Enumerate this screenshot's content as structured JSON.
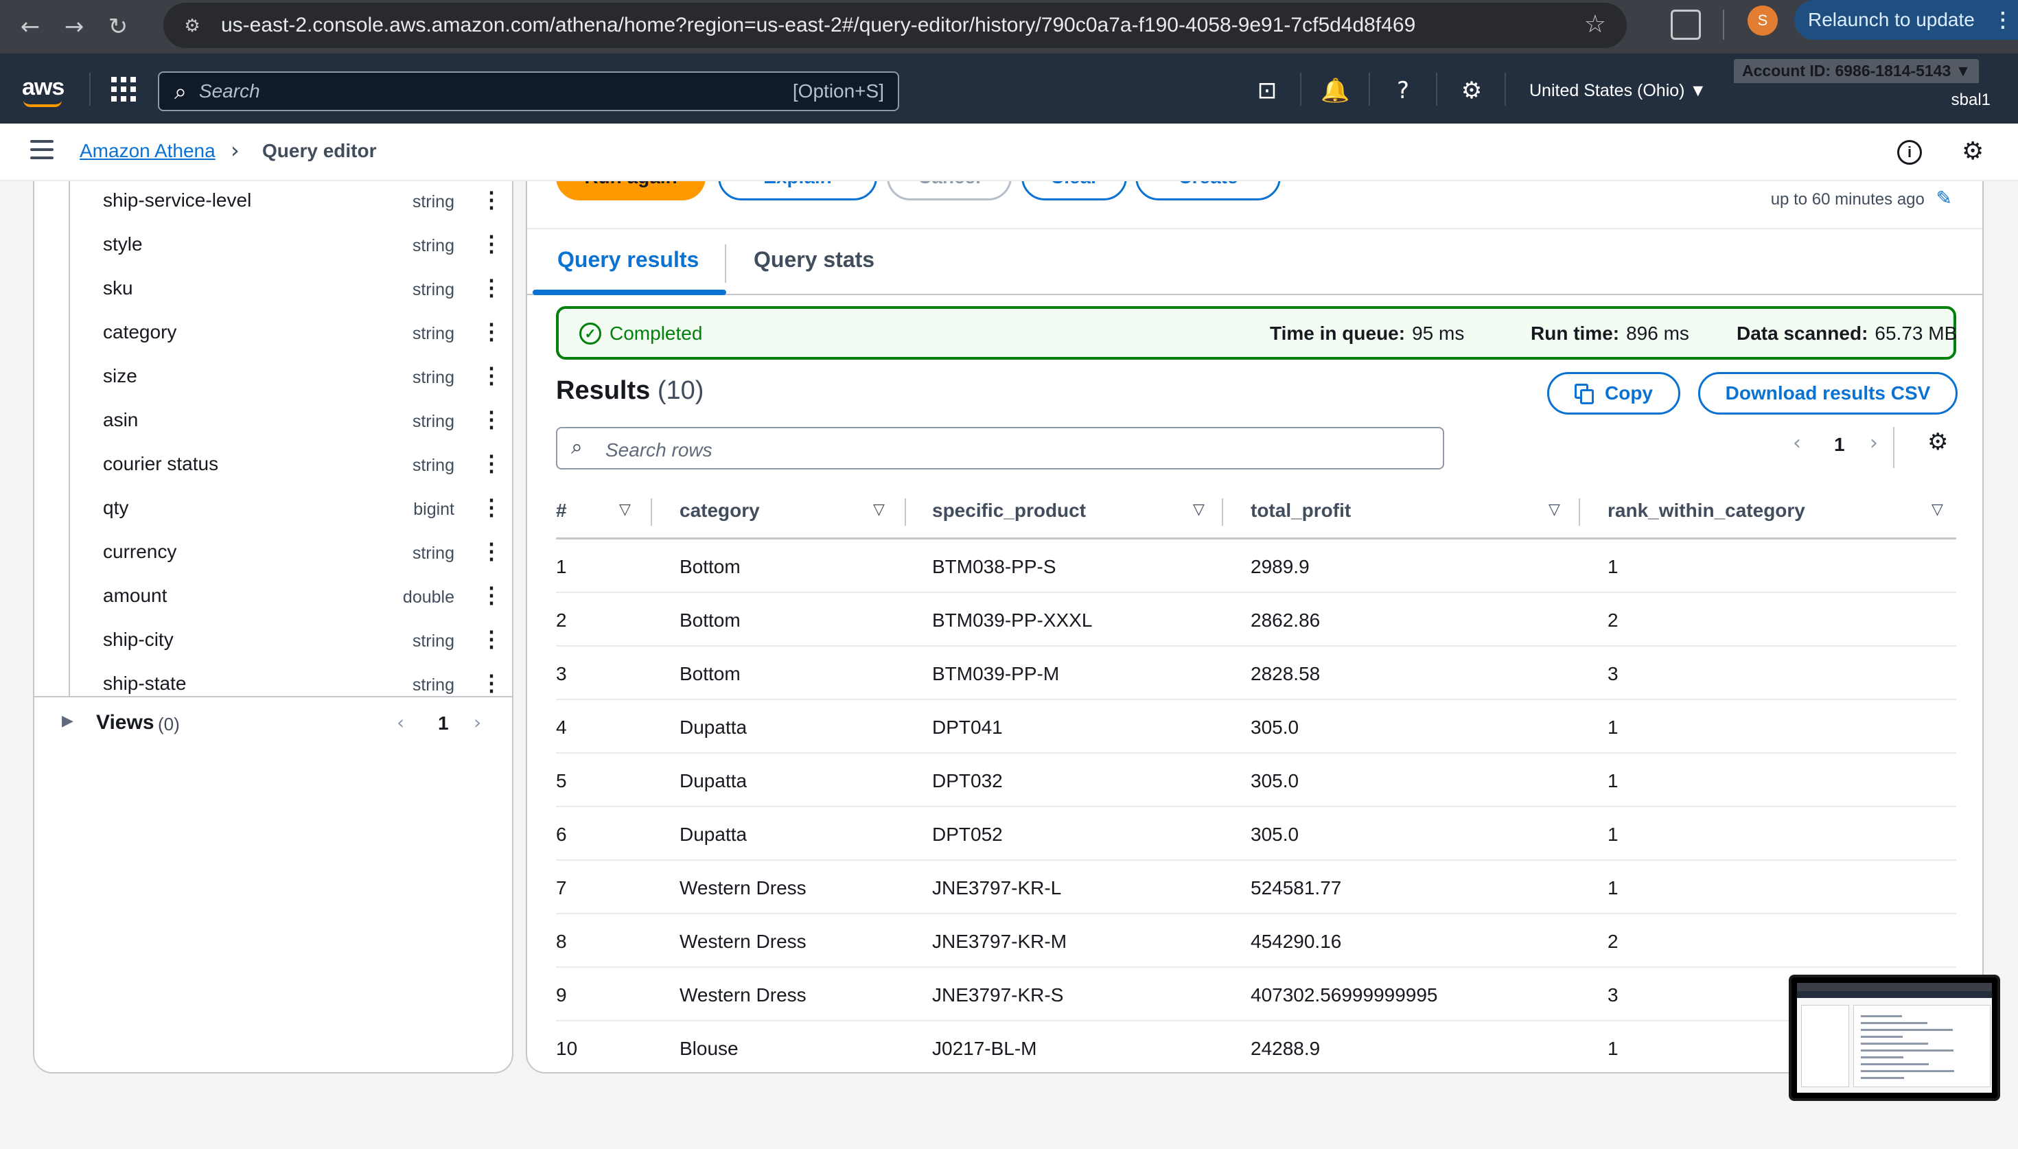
{
  "browser": {
    "url": "us-east-2.console.aws.amazon.com/athena/home?region=us-east-2#/query-editor/history/790c0a7a-f190-4058-9e91-7cf5d4d8f469",
    "profile_initial": "S",
    "relaunch_label": "Relaunch to update"
  },
  "aws": {
    "logo": "aws",
    "search_placeholder": "Search",
    "search_shortcut": "[Option+S]",
    "region": "United States (Ohio) ▼",
    "account": "Account ID: 6986-1814-5143 ▼",
    "user": "sbal1"
  },
  "breadcrumb": {
    "service": "Amazon Athena",
    "current": "Query editor"
  },
  "schema": {
    "fields": [
      {
        "name": "ship-service-level",
        "type": "string"
      },
      {
        "name": "style",
        "type": "string"
      },
      {
        "name": "sku",
        "type": "string"
      },
      {
        "name": "category",
        "type": "string"
      },
      {
        "name": "size",
        "type": "string"
      },
      {
        "name": "asin",
        "type": "string"
      },
      {
        "name": "courier status",
        "type": "string"
      },
      {
        "name": "qty",
        "type": "bigint"
      },
      {
        "name": "currency",
        "type": "string"
      },
      {
        "name": "amount",
        "type": "double"
      },
      {
        "name": "ship-city",
        "type": "string"
      },
      {
        "name": "ship-state",
        "type": "string"
      }
    ],
    "views_label": "Views",
    "views_count": "(0)",
    "views_page": "1"
  },
  "toolbar": {
    "run_again": "Run again",
    "explain": "Explain",
    "cancel": "Cancel",
    "clear": "Clear",
    "create": "Create",
    "refresh_note": "up to 60 minutes ago"
  },
  "tabs": {
    "results": "Query results",
    "stats": "Query stats"
  },
  "status": {
    "text": "Completed",
    "queue_label": "Time in queue:",
    "queue_value": "95 ms",
    "run_label": "Run time:",
    "run_value": "896 ms",
    "scanned_label": "Data scanned:",
    "scanned_value": "65.73 MB"
  },
  "results": {
    "title": "Results",
    "count": "(10)",
    "copy_label": "Copy",
    "download_label": "Download results CSV",
    "search_placeholder": "Search rows",
    "page": "1",
    "columns": [
      "#",
      "category",
      "specific_product",
      "total_profit",
      "rank_within_category"
    ],
    "rows": [
      [
        "1",
        "Bottom",
        "BTM038-PP-S",
        "2989.9",
        "1"
      ],
      [
        "2",
        "Bottom",
        "BTM039-PP-XXXL",
        "2862.86",
        "2"
      ],
      [
        "3",
        "Bottom",
        "BTM039-PP-M",
        "2828.58",
        "3"
      ],
      [
        "4",
        "Dupatta",
        "DPT041",
        "305.0",
        "1"
      ],
      [
        "5",
        "Dupatta",
        "DPT032",
        "305.0",
        "1"
      ],
      [
        "6",
        "Dupatta",
        "DPT052",
        "305.0",
        "1"
      ],
      [
        "7",
        "Western Dress",
        "JNE3797-KR-L",
        "524581.77",
        "1"
      ],
      [
        "8",
        "Western Dress",
        "JNE3797-KR-M",
        "454290.16",
        "2"
      ],
      [
        "9",
        "Western Dress",
        "JNE3797-KR-S",
        "407302.56999999995",
        "3"
      ],
      [
        "10",
        "Blouse",
        "J0217-BL-M",
        "24288.9",
        "1"
      ]
    ]
  }
}
